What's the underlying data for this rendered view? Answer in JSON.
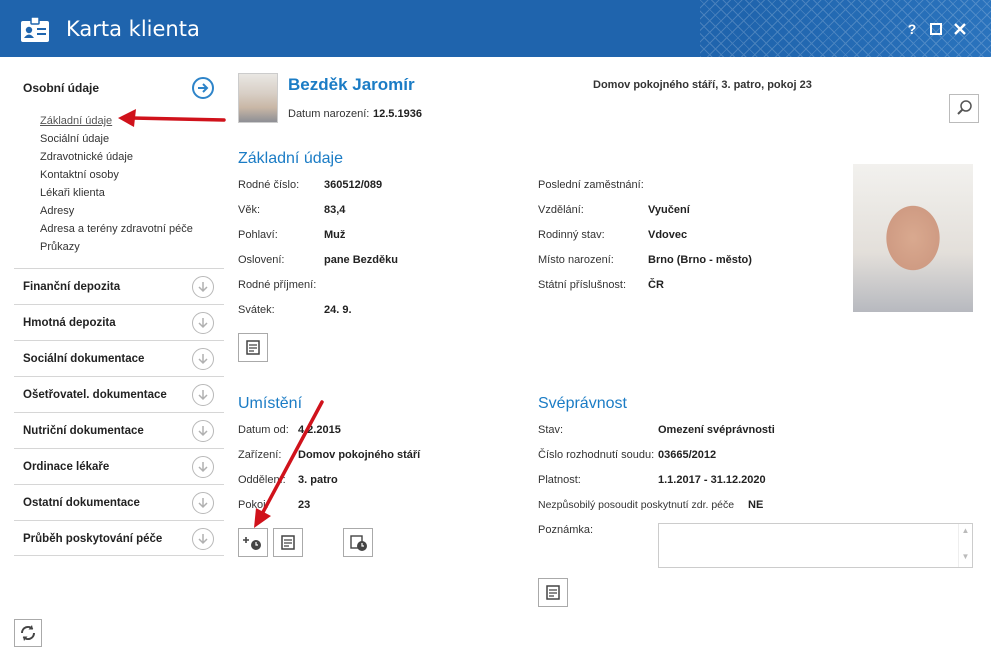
{
  "window": {
    "title": "Karta klienta",
    "help": "?",
    "maximize": "□",
    "close": "✕"
  },
  "sidebar": {
    "active_section": "Osobní údaje",
    "sub_items": [
      "Základní údaje",
      "Sociální údaje",
      "Zdravotnické údaje",
      "Kontaktní osoby",
      "Lékaři klienta",
      "Adresy",
      "Adresa a terény zdravotní péče",
      "Průkazy"
    ],
    "sections": [
      "Finanční depozita",
      "Hmotná depozita",
      "Sociální dokumentace",
      "Ošetřovatel. dokumentace",
      "Nutriční dokumentace",
      "Ordinace lékaře",
      "Ostatní dokumentace",
      "Průběh poskytování péče"
    ]
  },
  "client": {
    "name": "Bezděk Jaromír",
    "dob_label": "Datum narození:",
    "dob": "12.5.1936",
    "location": "Domov pokojného stáří, 3. patro, pokoj 23"
  },
  "basic": {
    "title": "Základní údaje",
    "left": [
      {
        "label": "Rodné číslo:",
        "value": "360512/089"
      },
      {
        "label": "Věk:",
        "value": "83,4"
      },
      {
        "label": "Pohlaví:",
        "value": "Muž"
      },
      {
        "label": "Oslovení:",
        "value": "pane Bezděku"
      },
      {
        "label": "Rodné příjmení:",
        "value": ""
      },
      {
        "label": "Svátek:",
        "value": "24. 9."
      }
    ],
    "right": [
      {
        "label": "Poslední zaměstnání:",
        "value": ""
      },
      {
        "label": "Vzdělání:",
        "value": "Vyučení"
      },
      {
        "label": "Rodinný stav:",
        "value": "Vdovec"
      },
      {
        "label": "Místo narození:",
        "value": "Brno (Brno - město)"
      },
      {
        "label": "Státní příslušnost:",
        "value": "ČR"
      }
    ]
  },
  "placement": {
    "title": "Umístění",
    "rows": [
      {
        "label": "Datum od:",
        "value": "4.2.2015"
      },
      {
        "label": "Zařízení:",
        "value": "Domov pokojného stáří"
      },
      {
        "label": "Oddělení:",
        "value": "3. patro"
      },
      {
        "label": "Pokoj:",
        "value": "23"
      }
    ]
  },
  "capacity": {
    "title": "Svéprávnost",
    "rows": [
      {
        "label": "Stav:",
        "value": "Omezení svéprávnosti"
      },
      {
        "label": "Číslo rozhodnutí soudu:",
        "value": "03665/2012"
      },
      {
        "label": "Platnost:",
        "value": "1.1.2017 - 31.12.2020"
      },
      {
        "label": "Nezpůsobilý posoudit poskytnutí zdr. péče",
        "value": "NE"
      }
    ],
    "note_label": "Poznámka:"
  },
  "colors": {
    "titlebar": "#1f65ae",
    "accent": "#1b7cc5",
    "annotation": "#d0121b"
  }
}
